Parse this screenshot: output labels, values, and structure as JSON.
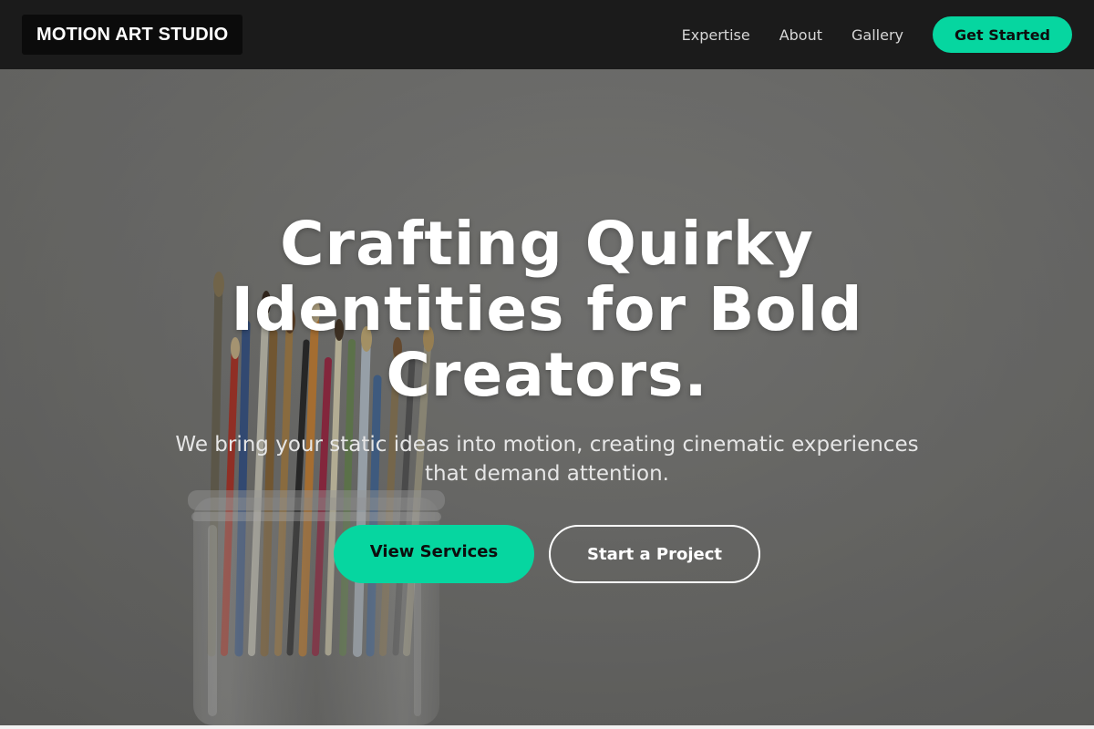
{
  "nav": {
    "logo": "MOTION ART STUDIO",
    "links": [
      "Expertise",
      "About",
      "Gallery"
    ],
    "cta": "Get Started"
  },
  "hero": {
    "title": "Crafting Quirky Identities for Bold Creators.",
    "subtitle": "We bring your static ideas into motion, creating cinematic experiences that demand attention.",
    "primary_button": "View Services",
    "secondary_button": "Start a Project",
    "background_image": "paintbrushes-in-glass-jar"
  },
  "colors": {
    "accent": "#06d6a0",
    "nav_bg": "#1b1b1b",
    "logo_bg": "#0b0b0b"
  }
}
